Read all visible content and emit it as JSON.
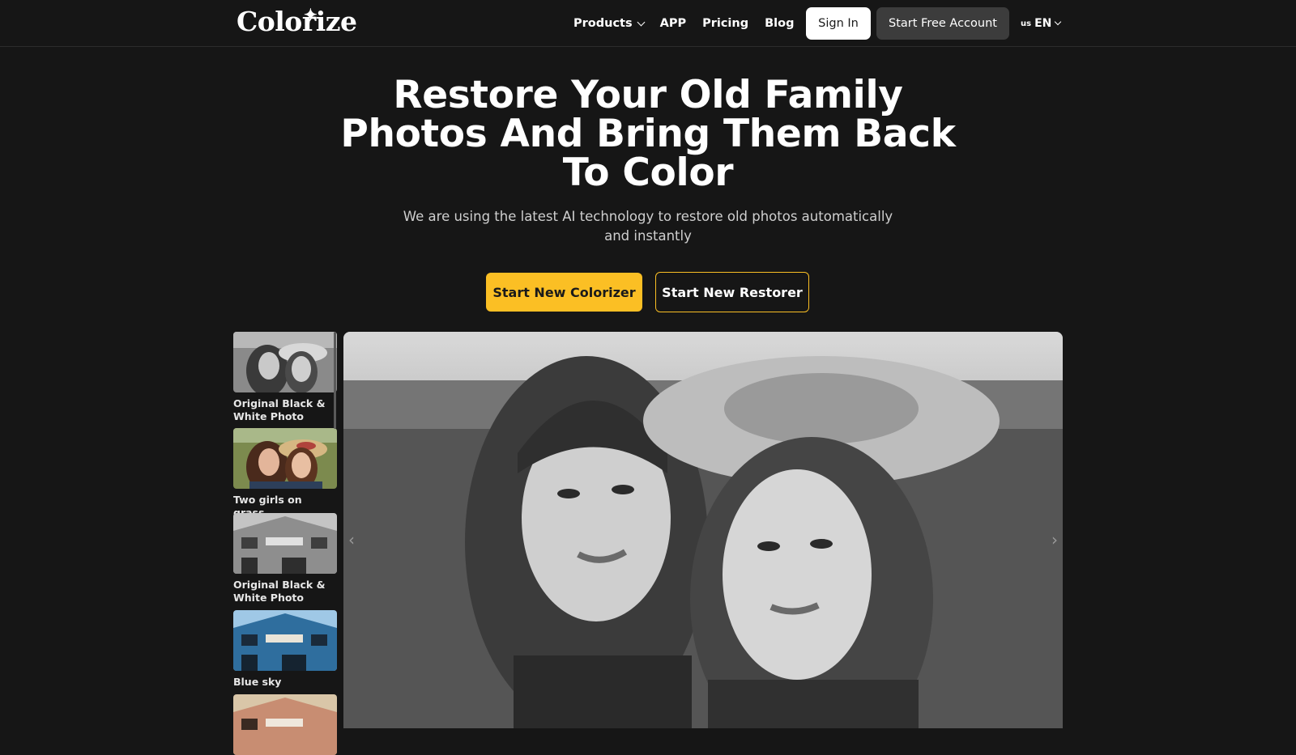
{
  "brand": {
    "name": "Colorize"
  },
  "nav": {
    "products": "Products",
    "app": "APP",
    "pricing": "Pricing",
    "blog": "Blog",
    "sign_in": "Sign In",
    "start_free": "Start Free Account",
    "lang_flag": "us",
    "lang_code": "EN"
  },
  "hero": {
    "title": "Restore Your Old Family Photos And Bring Them Back To Color",
    "subtitle": "We are using the latest AI technology to restore old photos automatically and instantly",
    "btn_colorizer": "Start New Colorizer",
    "btn_restorer": "Start New Restorer"
  },
  "gallery": {
    "thumbs": [
      {
        "caption": "Original Black & White Photo",
        "style": "bw-girls"
      },
      {
        "caption": "Two girls on grass",
        "style": "color-girls"
      },
      {
        "caption": "Original Black & White Photo",
        "style": "bw-house"
      },
      {
        "caption": "Blue sky",
        "style": "blue-house"
      },
      {
        "caption": "",
        "style": "pink-house"
      }
    ],
    "prev_icon": "chevron-left-icon",
    "next_icon": "chevron-right-icon"
  },
  "colors": {
    "accent": "#fbbf24",
    "background": "#161616",
    "button_dark": "#3c3c3c"
  }
}
